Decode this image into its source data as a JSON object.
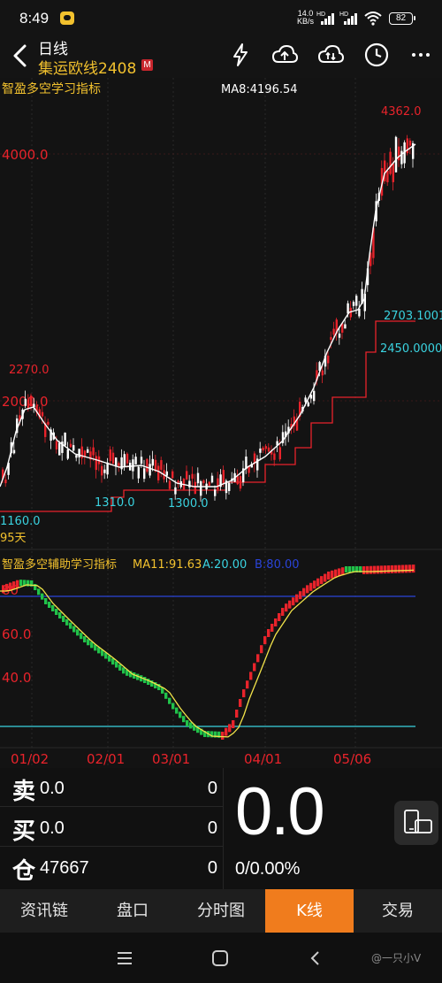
{
  "status": {
    "time": "8:49",
    "net_speed_value": "14.0",
    "net_speed_unit": "KB/s",
    "hd1": "HD",
    "hd2": "HD",
    "battery": "82"
  },
  "header": {
    "title": "日线",
    "instrument": "集运欧线2408",
    "badge": "M",
    "icons": [
      "flash-icon",
      "cloud-upload-icon",
      "cloud-sync-icon",
      "clock-icon",
      "more-icon"
    ]
  },
  "main_chart": {
    "indicator_name": "智盈多空学习指标",
    "ma_label": "MA8:4196.54",
    "price_labels": [
      "4000.0",
      "2000.0"
    ],
    "annotations": {
      "high": "4362.0",
      "peak_left": "2270.0",
      "low_left": "1160.0",
      "low_mid1": "1310.0",
      "low_mid2": "1300.0",
      "level1": "2703.10010",
      "level2": "2450.0000"
    },
    "period_label": "95天"
  },
  "sub_chart": {
    "indicator_name": "智盈多空辅助学习指标",
    "ma_label": "MA11:91.63",
    "a_label": "A:20.00",
    "extra_label": "B:80.00",
    "y_labels": [
      "80",
      "60.0",
      "40.0"
    ]
  },
  "date_axis": [
    "01/02",
    "02/01",
    "03/01",
    "04/01",
    "05/06"
  ],
  "quote": {
    "sell_label": "卖",
    "sell_price": "0.0",
    "sell_vol": "0",
    "buy_label": "买",
    "buy_price": "0.0",
    "buy_vol": "0",
    "pos_label": "仓",
    "pos_value": "47667",
    "pos_vol": "0",
    "last_price": "0.0",
    "change": "0/0.00%"
  },
  "tabs": [
    {
      "label": "资讯链",
      "active": false
    },
    {
      "label": "盘口",
      "active": false
    },
    {
      "label": "分时图",
      "active": false
    },
    {
      "label": "K线",
      "active": true
    },
    {
      "label": "交易",
      "active": false
    }
  ],
  "watermark": "@一只小V",
  "colors": {
    "up": "#e8232b",
    "down": "#ffffff",
    "ma_white": "#ffffff",
    "green": "#21c24a",
    "yellow": "#f2c12e",
    "cyan": "#3ad3e0",
    "blue": "#2a44d8",
    "orange": "#f07c1d",
    "background": "#131313"
  }
}
